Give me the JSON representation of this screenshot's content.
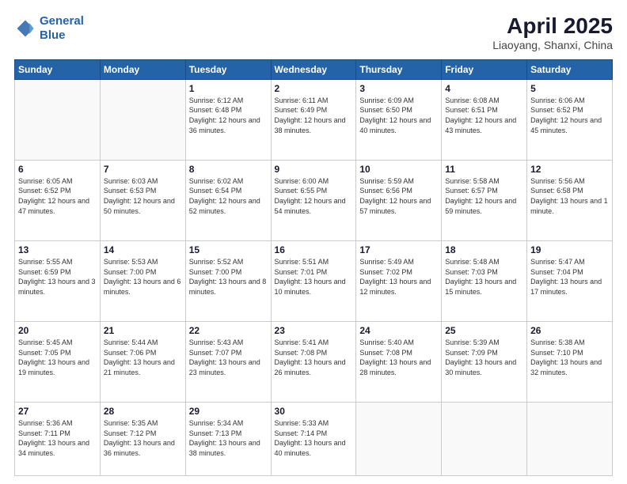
{
  "logo": {
    "line1": "General",
    "line2": "Blue"
  },
  "title": "April 2025",
  "subtitle": "Liaoyang, Shanxi, China",
  "weekdays": [
    "Sunday",
    "Monday",
    "Tuesday",
    "Wednesday",
    "Thursday",
    "Friday",
    "Saturday"
  ],
  "days": [
    {
      "date": null
    },
    {
      "date": null
    },
    {
      "date": 1,
      "sunrise": "Sunrise: 6:12 AM",
      "sunset": "Sunset: 6:48 PM",
      "daylight": "Daylight: 12 hours and 36 minutes."
    },
    {
      "date": 2,
      "sunrise": "Sunrise: 6:11 AM",
      "sunset": "Sunset: 6:49 PM",
      "daylight": "Daylight: 12 hours and 38 minutes."
    },
    {
      "date": 3,
      "sunrise": "Sunrise: 6:09 AM",
      "sunset": "Sunset: 6:50 PM",
      "daylight": "Daylight: 12 hours and 40 minutes."
    },
    {
      "date": 4,
      "sunrise": "Sunrise: 6:08 AM",
      "sunset": "Sunset: 6:51 PM",
      "daylight": "Daylight: 12 hours and 43 minutes."
    },
    {
      "date": 5,
      "sunrise": "Sunrise: 6:06 AM",
      "sunset": "Sunset: 6:52 PM",
      "daylight": "Daylight: 12 hours and 45 minutes."
    },
    {
      "date": 6,
      "sunrise": "Sunrise: 6:05 AM",
      "sunset": "Sunset: 6:52 PM",
      "daylight": "Daylight: 12 hours and 47 minutes."
    },
    {
      "date": 7,
      "sunrise": "Sunrise: 6:03 AM",
      "sunset": "Sunset: 6:53 PM",
      "daylight": "Daylight: 12 hours and 50 minutes."
    },
    {
      "date": 8,
      "sunrise": "Sunrise: 6:02 AM",
      "sunset": "Sunset: 6:54 PM",
      "daylight": "Daylight: 12 hours and 52 minutes."
    },
    {
      "date": 9,
      "sunrise": "Sunrise: 6:00 AM",
      "sunset": "Sunset: 6:55 PM",
      "daylight": "Daylight: 12 hours and 54 minutes."
    },
    {
      "date": 10,
      "sunrise": "Sunrise: 5:59 AM",
      "sunset": "Sunset: 6:56 PM",
      "daylight": "Daylight: 12 hours and 57 minutes."
    },
    {
      "date": 11,
      "sunrise": "Sunrise: 5:58 AM",
      "sunset": "Sunset: 6:57 PM",
      "daylight": "Daylight: 12 hours and 59 minutes."
    },
    {
      "date": 12,
      "sunrise": "Sunrise: 5:56 AM",
      "sunset": "Sunset: 6:58 PM",
      "daylight": "Daylight: 13 hours and 1 minute."
    },
    {
      "date": 13,
      "sunrise": "Sunrise: 5:55 AM",
      "sunset": "Sunset: 6:59 PM",
      "daylight": "Daylight: 13 hours and 3 minutes."
    },
    {
      "date": 14,
      "sunrise": "Sunrise: 5:53 AM",
      "sunset": "Sunset: 7:00 PM",
      "daylight": "Daylight: 13 hours and 6 minutes."
    },
    {
      "date": 15,
      "sunrise": "Sunrise: 5:52 AM",
      "sunset": "Sunset: 7:00 PM",
      "daylight": "Daylight: 13 hours and 8 minutes."
    },
    {
      "date": 16,
      "sunrise": "Sunrise: 5:51 AM",
      "sunset": "Sunset: 7:01 PM",
      "daylight": "Daylight: 13 hours and 10 minutes."
    },
    {
      "date": 17,
      "sunrise": "Sunrise: 5:49 AM",
      "sunset": "Sunset: 7:02 PM",
      "daylight": "Daylight: 13 hours and 12 minutes."
    },
    {
      "date": 18,
      "sunrise": "Sunrise: 5:48 AM",
      "sunset": "Sunset: 7:03 PM",
      "daylight": "Daylight: 13 hours and 15 minutes."
    },
    {
      "date": 19,
      "sunrise": "Sunrise: 5:47 AM",
      "sunset": "Sunset: 7:04 PM",
      "daylight": "Daylight: 13 hours and 17 minutes."
    },
    {
      "date": 20,
      "sunrise": "Sunrise: 5:45 AM",
      "sunset": "Sunset: 7:05 PM",
      "daylight": "Daylight: 13 hours and 19 minutes."
    },
    {
      "date": 21,
      "sunrise": "Sunrise: 5:44 AM",
      "sunset": "Sunset: 7:06 PM",
      "daylight": "Daylight: 13 hours and 21 minutes."
    },
    {
      "date": 22,
      "sunrise": "Sunrise: 5:43 AM",
      "sunset": "Sunset: 7:07 PM",
      "daylight": "Daylight: 13 hours and 23 minutes."
    },
    {
      "date": 23,
      "sunrise": "Sunrise: 5:41 AM",
      "sunset": "Sunset: 7:08 PM",
      "daylight": "Daylight: 13 hours and 26 minutes."
    },
    {
      "date": 24,
      "sunrise": "Sunrise: 5:40 AM",
      "sunset": "Sunset: 7:08 PM",
      "daylight": "Daylight: 13 hours and 28 minutes."
    },
    {
      "date": 25,
      "sunrise": "Sunrise: 5:39 AM",
      "sunset": "Sunset: 7:09 PM",
      "daylight": "Daylight: 13 hours and 30 minutes."
    },
    {
      "date": 26,
      "sunrise": "Sunrise: 5:38 AM",
      "sunset": "Sunset: 7:10 PM",
      "daylight": "Daylight: 13 hours and 32 minutes."
    },
    {
      "date": 27,
      "sunrise": "Sunrise: 5:36 AM",
      "sunset": "Sunset: 7:11 PM",
      "daylight": "Daylight: 13 hours and 34 minutes."
    },
    {
      "date": 28,
      "sunrise": "Sunrise: 5:35 AM",
      "sunset": "Sunset: 7:12 PM",
      "daylight": "Daylight: 13 hours and 36 minutes."
    },
    {
      "date": 29,
      "sunrise": "Sunrise: 5:34 AM",
      "sunset": "Sunset: 7:13 PM",
      "daylight": "Daylight: 13 hours and 38 minutes."
    },
    {
      "date": 30,
      "sunrise": "Sunrise: 5:33 AM",
      "sunset": "Sunset: 7:14 PM",
      "daylight": "Daylight: 13 hours and 40 minutes."
    },
    {
      "date": null
    },
    {
      "date": null
    },
    {
      "date": null
    }
  ]
}
